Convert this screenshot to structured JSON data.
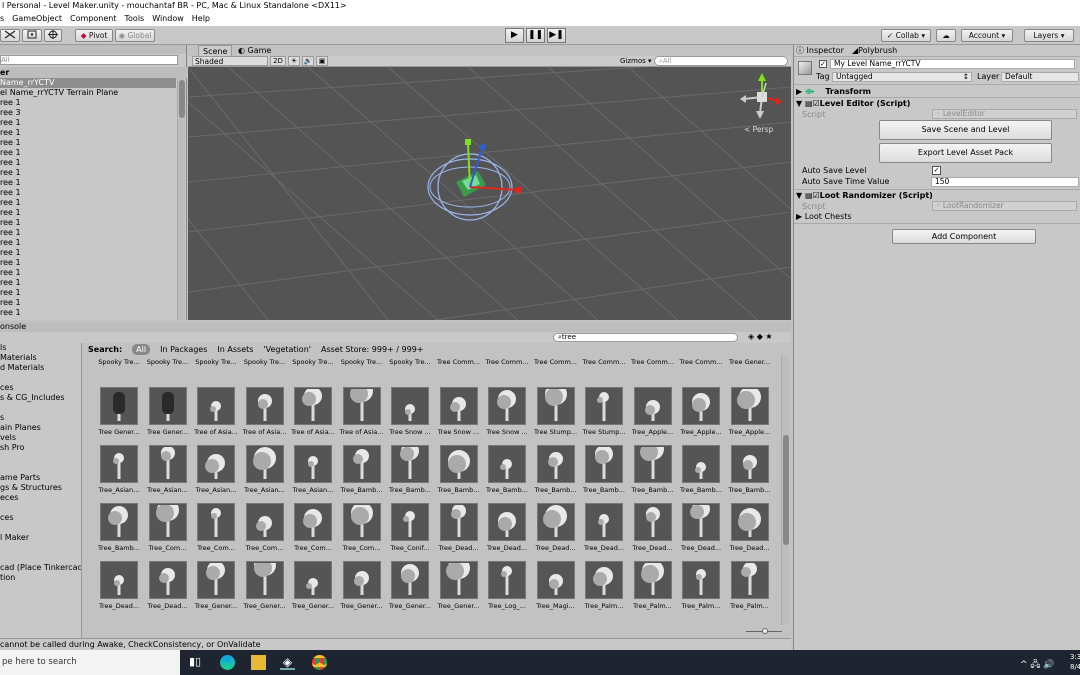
{
  "window_title": "l Personal - Level Maker.unity - mouchantaf BR - PC, Mac & Linux Standalone <DX11>",
  "menu": [
    "s",
    "GameObject",
    "Component",
    "Tools",
    "Window",
    "Help"
  ],
  "toolbar": {
    "pivot": "Pivot",
    "global": "Global",
    "collab": "Collab",
    "account": "Account",
    "layers": "Layers"
  },
  "hierarchy": {
    "search_placeholder": "All",
    "scene_label": "er",
    "items": [
      "Name_rrYCTV",
      "el Name_rrYCTV Terrain Plane",
      "ree 1",
      "ree 3",
      "ree 1",
      "ree 1",
      "ree 1",
      "ree 1",
      "ree 1",
      "ree 1",
      "ree 1",
      "ree 1",
      "ree 1",
      "ree 1",
      "ree 1",
      "ree 1",
      "ree 1",
      "ree 1",
      "ree 1",
      "ree 1",
      "ree 1",
      "ree 1",
      "ree 1",
      "ree 1"
    ]
  },
  "scene": {
    "tab_scene": "Scene",
    "tab_game": "Game",
    "shading": "Shaded",
    "mode_2d": "2D",
    "gizmos": "Gizmos",
    "search_placeholder": "All",
    "persp": "< Persp"
  },
  "inspector": {
    "tab_inspector": "Inspector",
    "tab_polybrush": "Polybrush",
    "object_name": "My Level Name_rrYCTV",
    "tag_label": "Tag",
    "tag_value": "Untagged",
    "layer_label": "Layer",
    "layer_value": "Default",
    "transform": "Transform",
    "level_editor": "Level Editor (Script)",
    "script_label": "Script",
    "level_editor_script": "LevelEditor",
    "save_btn": "Save Scene and Level",
    "export_btn": "Export Level Asset Pack",
    "auto_save_label": "Auto Save Level",
    "auto_save_time_label": "Auto Save Time Value",
    "auto_save_time_value": "150",
    "loot_randomizer": "Loot Randomizer (Script)",
    "loot_script": "LootRandomizer",
    "loot_chests": "Loot Chests",
    "add_component": "Add Component"
  },
  "project": {
    "tab": "onsole",
    "search_value": "tree",
    "search_label": "Search:",
    "scope_all": "All",
    "scope_packages": "In Packages",
    "scope_assets": "In Assets",
    "scope_vegetation": "'Vegetation'",
    "scope_store": "Asset Store: 999+ / 999+",
    "left_items": [
      "ls",
      "Materials",
      "d Materials",
      "",
      "ces",
      "s & CG_Includes",
      "",
      "s",
      "ain Planes",
      "vels",
      "sh Pro",
      "",
      "",
      "ame Parts",
      "gs & Structures",
      "eces",
      "",
      "ces",
      "",
      "l Maker",
      "",
      "",
      "cad (Place Tinkercad C",
      "tion"
    ],
    "rows": [
      [
        "Spooky Tre...",
        "Spooky Tre...",
        "Spooky Tre...",
        "Spooky Tre...",
        "Spooky Tre...",
        "Spooky Tre...",
        "Spooky Tre...",
        "Tree Comm...",
        "Tree Comm...",
        "Tree Comm...",
        "Tree Comm...",
        "Tree Comm...",
        "Tree Comm...",
        "Tree Gener..."
      ],
      [
        "Tree Gener...",
        "Tree Gener...",
        "Tree of Asia...",
        "Tree of Asia...",
        "Tree of Asia...",
        "Tree of Asia...",
        "Tree Snow ...",
        "Tree Snow ...",
        "Tree Snow ...",
        "Tree Stump...",
        "Tree Stump...",
        "Tree_Apple...",
        "Tree_Apple...",
        "Tree_Apple..."
      ],
      [
        "Tree_Asian...",
        "Tree_Asian...",
        "Tree_Asian...",
        "Tree_Asian...",
        "Tree_Asian...",
        "Tree_Bamb...",
        "Tree_Bamb...",
        "Tree_Bamb...",
        "Tree_Bamb...",
        "Tree_Bamb...",
        "Tree_Bamb...",
        "Tree_Bamb...",
        "Tree_Bamb...",
        "Tree_Bamb..."
      ],
      [
        "Tree_Bamb...",
        "Tree_Com...",
        "Tree_Com...",
        "Tree_Com...",
        "Tree_Com...",
        "Tree_Com...",
        "Tree_Conif...",
        "Tree_Dead...",
        "Tree_Dead...",
        "Tree_Dead...",
        "Tree_Dead...",
        "Tree_Dead...",
        "Tree_Dead...",
        "Tree_Dead..."
      ],
      [
        "Tree_Dead...",
        "Tree_Dead...",
        "Tree_Gener...",
        "Tree_Gener...",
        "Tree_Gener...",
        "Tree_Gener...",
        "Tree_Gener...",
        "Tree_Gener...",
        "Tree_Log_...",
        "Tree_Magi...",
        "Tree_Palm...",
        "Tree_Palm...",
        "Tree_Palm...",
        "Tree_Palm..."
      ]
    ]
  },
  "status": "cannot be called during Awake, CheckConsistency, or OnValidate",
  "taskbar": {
    "search": "pe here to search",
    "time": "3:3",
    "date": "8/4"
  },
  "colors": {
    "unity_grey": "#c8c8c8",
    "scene_bg": "#545454",
    "selection": "#8e8e8e",
    "taskbar": "#1f2530"
  }
}
